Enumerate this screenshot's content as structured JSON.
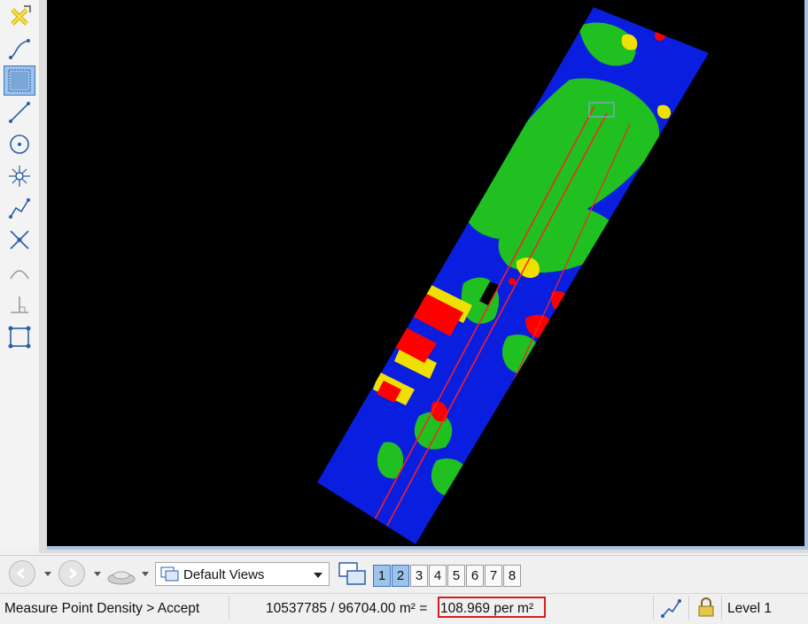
{
  "toolbar": {
    "tools": [
      {
        "name": "select-element-icon",
        "active": false
      },
      {
        "name": "draw-curve-icon",
        "active": false
      },
      {
        "name": "fence-area-icon",
        "active": true
      },
      {
        "name": "draw-line-icon",
        "active": false
      },
      {
        "name": "draw-circle-icon",
        "active": false
      },
      {
        "name": "place-point-icon",
        "active": false
      },
      {
        "name": "draw-linestring-icon",
        "active": false
      },
      {
        "name": "intersection-icon",
        "active": false
      },
      {
        "name": "arc-icon",
        "active": false
      },
      {
        "name": "perpendicular-icon",
        "active": false
      },
      {
        "name": "fit-view-icon",
        "active": false
      }
    ]
  },
  "nav": {
    "views_label": "Default Views",
    "view_numbers": [
      "1",
      "2",
      "3",
      "4",
      "5",
      "6",
      "7",
      "8"
    ],
    "active_views": [
      "1",
      "2"
    ]
  },
  "status": {
    "command": "Measure Point Density > Accept",
    "points_area": "10537785 / 96704.00 m² =",
    "density": "108.969 per m²",
    "level": "Level 1"
  },
  "colors": {
    "accent_border": "#d0201c",
    "viewport_background": "#000000",
    "point_low": "#0a1ee0",
    "point_mid": "#1fc020",
    "point_high_mid": "#f0e000",
    "point_high": "#ff0000"
  }
}
